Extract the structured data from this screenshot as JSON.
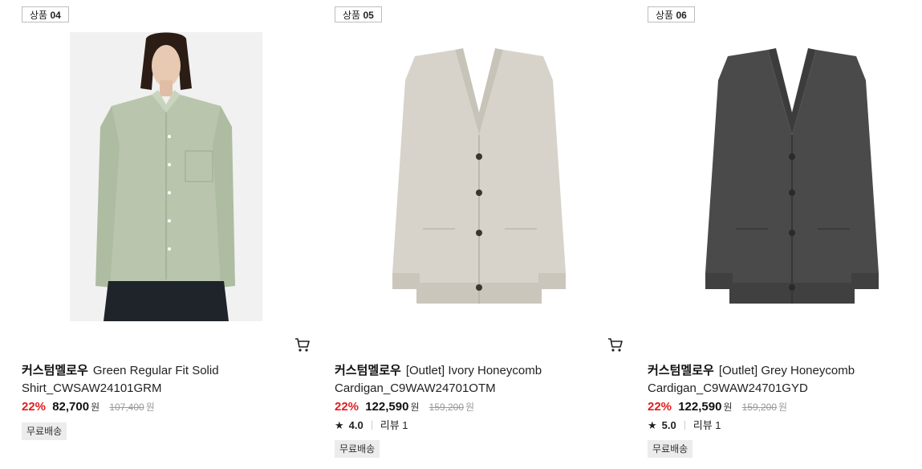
{
  "products": [
    {
      "tag_prefix": "상품",
      "tag_num": "04",
      "brand": "커스텀멜로우",
      "name": "Green Regular Fit Solid Shirt_CWSAW24101GRM",
      "discount": "22%",
      "price": "82,700",
      "currency": "원",
      "original_price": "107,400",
      "original_currency": "원",
      "free_shipping": "무료배송",
      "image_icon": "green-shirt-model-image",
      "color": "#b9c6ad"
    },
    {
      "tag_prefix": "상품",
      "tag_num": "05",
      "brand": "커스텀멜로우",
      "name": "[Outlet] Ivory Honeycomb Cardigan_C9WAW24701OTM",
      "discount": "22%",
      "price": "122,590",
      "currency": "원",
      "original_price": "159,200",
      "original_currency": "원",
      "rating": "4.0",
      "review_label": "리뷰 1",
      "free_shipping": "무료배송",
      "image_icon": "ivory-cardigan-image",
      "color": "#d7d3ca"
    },
    {
      "tag_prefix": "상품",
      "tag_num": "06",
      "brand": "커스텀멜로우",
      "name": "[Outlet] Grey Honeycomb Cardigan_C9WAW24701GYD",
      "discount": "22%",
      "price": "122,590",
      "currency": "원",
      "original_price": "159,200",
      "original_currency": "원",
      "rating": "5.0",
      "review_label": "리뷰 1",
      "free_shipping": "무료배송",
      "image_icon": "grey-cardigan-image",
      "color": "#4a4a4a"
    }
  ],
  "icons": {
    "cart": "cart-icon",
    "star": "star-icon"
  }
}
